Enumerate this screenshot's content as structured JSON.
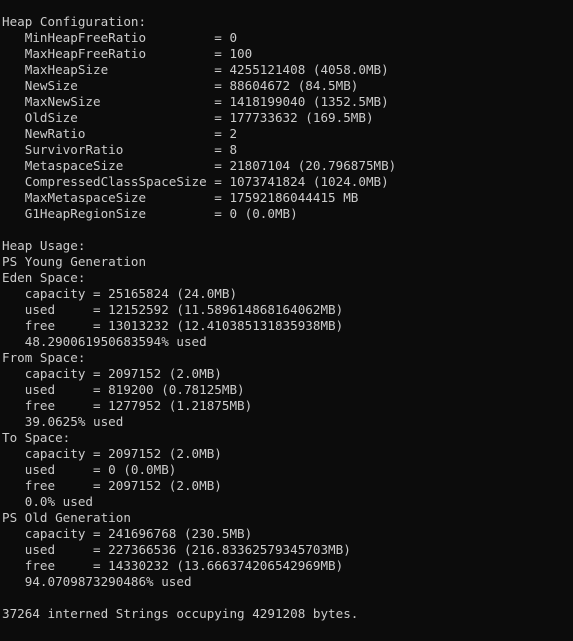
{
  "terminal": {
    "background_color": "#0c0c0c",
    "text_color": "#cccccc",
    "output_lines": [
      "Heap Configuration:",
      "   MinHeapFreeRatio         = 0",
      "   MaxHeapFreeRatio         = 100",
      "   MaxHeapSize              = 4255121408 (4058.0MB)",
      "   NewSize                  = 88604672 (84.5MB)",
      "   MaxNewSize               = 1418199040 (1352.5MB)",
      "   OldSize                  = 177733632 (169.5MB)",
      "   NewRatio                 = 2",
      "   SurvivorRatio            = 8",
      "   MetaspaceSize            = 21807104 (20.796875MB)",
      "   CompressedClassSpaceSize = 1073741824 (1024.0MB)",
      "   MaxMetaspaceSize         = 17592186044415 MB",
      "   G1HeapRegionSize         = 0 (0.0MB)",
      "",
      "Heap Usage:",
      "PS Young Generation",
      "Eden Space:",
      "   capacity = 25165824 (24.0MB)",
      "   used     = 12152592 (11.589614868164062MB)",
      "   free     = 13013232 (12.410385131835938MB)",
      "   48.290061950683594% used",
      "From Space:",
      "   capacity = 2097152 (2.0MB)",
      "   used     = 819200 (0.78125MB)",
      "   free     = 1277952 (1.21875MB)",
      "   39.0625% used",
      "To Space:",
      "   capacity = 2097152 (2.0MB)",
      "   used     = 0 (0.0MB)",
      "   free     = 2097152 (2.0MB)",
      "   0.0% used",
      "PS Old Generation",
      "   capacity = 241696768 (230.5MB)",
      "   used     = 227366536 (216.83362579345703MB)",
      "   free     = 14330232 (13.666374206542969MB)",
      "   94.0709873290486% used",
      "",
      "37264 interned Strings occupying 4291208 bytes."
    ]
  }
}
